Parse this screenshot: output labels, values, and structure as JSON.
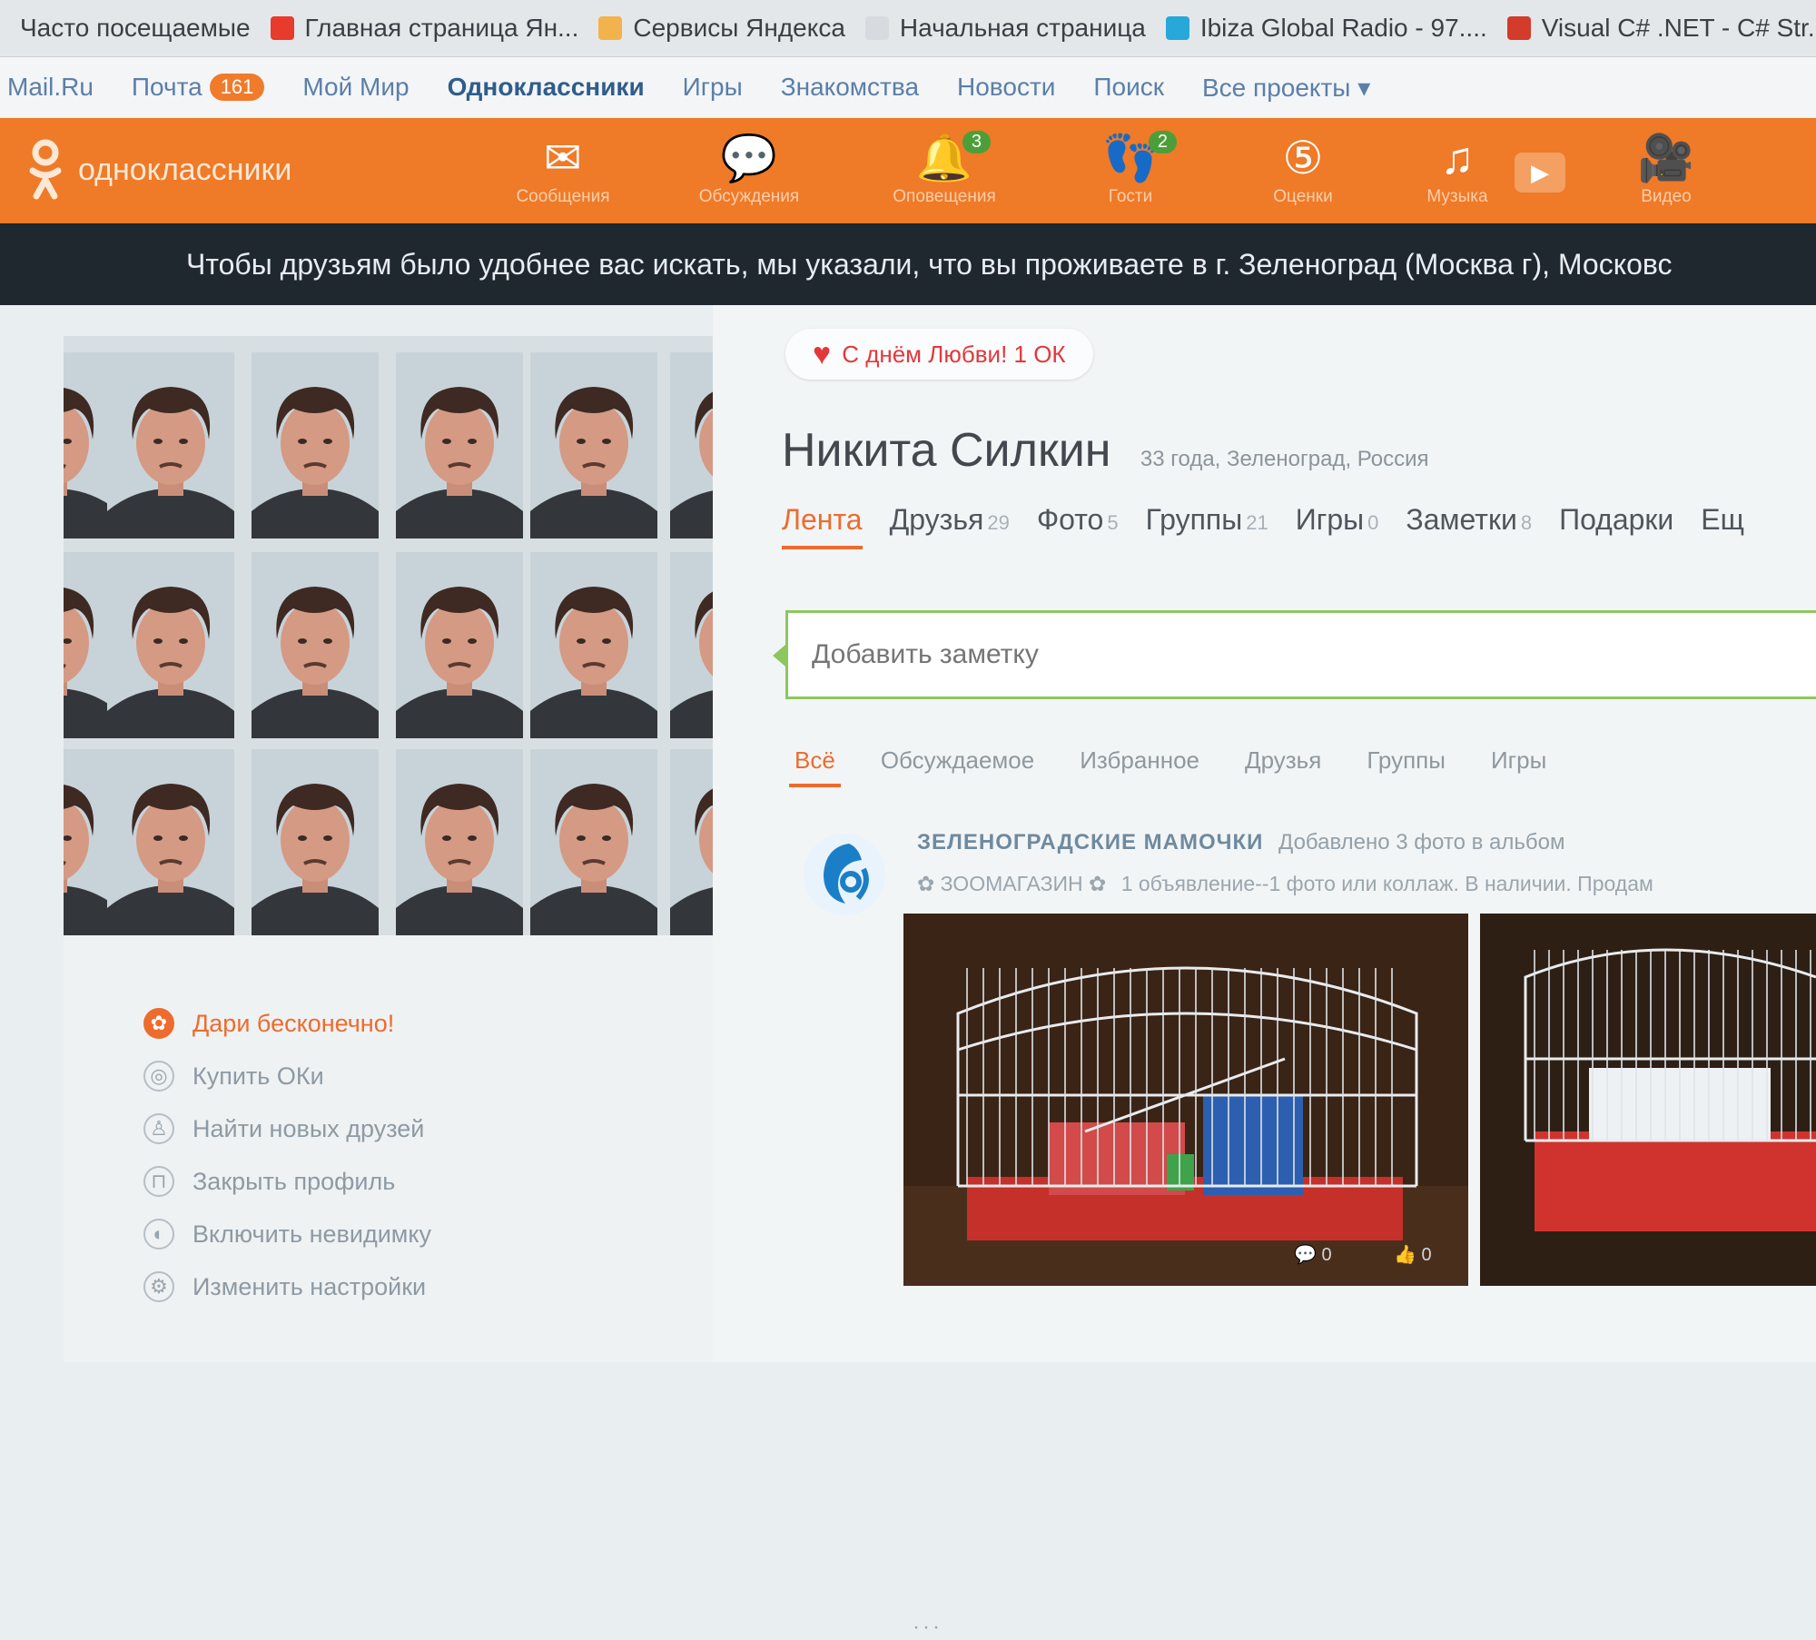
{
  "colors": {
    "accent": "#ef7a27",
    "link": "#5b7fa8",
    "notice_bg": "#1f272f",
    "note_border": "#8cc75e",
    "love": "#e3383a"
  },
  "bookmarks": [
    {
      "label": "Часто посещаемые",
      "icon": "gear-icon",
      "color": ""
    },
    {
      "label": "Главная страница Ян...",
      "icon": "yandex-icon",
      "color": "#e73b2c"
    },
    {
      "label": "Сервисы Яндекса",
      "icon": "folder-icon",
      "color": "#f3b34c"
    },
    {
      "label": "Начальная страница",
      "icon": "page-icon",
      "color": "#d7dade"
    },
    {
      "label": "Ibiza Global Radio - 97....",
      "icon": "radio-icon",
      "color": "#27a8d8"
    },
    {
      "label": "Visual C# .NET - C# Str...",
      "icon": "hl-icon",
      "color": "#d33b2b"
    }
  ],
  "portal": {
    "items": [
      "Mail.Ru",
      "Почта",
      "Мой Мир",
      "Одноклассники",
      "Игры",
      "Знакомства",
      "Новости",
      "Поиск",
      "Все проекты ▾"
    ],
    "mail_badge": "161"
  },
  "toolbar": {
    "logo": "одноклассники",
    "items": [
      {
        "label": "Сообщения",
        "icon": "envelope-icon",
        "badge": ""
      },
      {
        "label": "Обсуждения",
        "icon": "discussion-icon",
        "badge": ""
      },
      {
        "label": "Оповещения",
        "icon": "bell-icon",
        "badge": "3"
      },
      {
        "label": "Гости",
        "icon": "footprints-icon",
        "badge": "2"
      },
      {
        "label": "Оценки",
        "icon": "rating-icon",
        "badge": ""
      },
      {
        "label": "Музыка",
        "icon": "music-icon",
        "badge": ""
      },
      {
        "label": "Видео",
        "icon": "video-camera-icon",
        "badge": ""
      }
    ]
  },
  "notice": "Чтобы друзьям было удобнее вас искать, мы указали, что вы проживаете в г. Зеленоград (Москва г), Московс",
  "left_menu": [
    {
      "label": "Дари бесконечно!",
      "icon": "gift-icon"
    },
    {
      "label": "Купить ОКи",
      "icon": "coin-icon"
    },
    {
      "label": "Найти новых друзей",
      "icon": "person-icon"
    },
    {
      "label": "Закрыть профиль",
      "icon": "lock-icon"
    },
    {
      "label": "Включить невидимку",
      "icon": "invisible-icon"
    },
    {
      "label": "Изменить настройки",
      "icon": "settings-icon"
    }
  ],
  "profile": {
    "love_banner": "С днём Любви! 1 ОК",
    "name": "Никита Силкин",
    "meta": "33 года, Зеленоград, Россия",
    "tabs": [
      {
        "label": "Лента",
        "count": ""
      },
      {
        "label": "Друзья",
        "count": "29"
      },
      {
        "label": "Фото",
        "count": "5"
      },
      {
        "label": "Группы",
        "count": "21"
      },
      {
        "label": "Игры",
        "count": "0"
      },
      {
        "label": "Заметки",
        "count": "8"
      },
      {
        "label": "Подарки",
        "count": ""
      },
      {
        "label": "Ещ",
        "count": ""
      }
    ],
    "note_placeholder": "Добавить заметку"
  },
  "feed_tabs": [
    "Всё",
    "Обсуждаемое",
    "Избранное",
    "Друзья",
    "Группы",
    "Игры"
  ],
  "post": {
    "group": "ЗЕЛЕНОГРАДСКИЕ МАМОЧКИ",
    "action": "Добавлено 3 фото в альбом",
    "subtitle": "ЗООМАГАЗИН",
    "text": "1 объявление--1 фото или коллаж. В наличии. Продам",
    "comments": "0",
    "likes": "0",
    "more": "···"
  }
}
